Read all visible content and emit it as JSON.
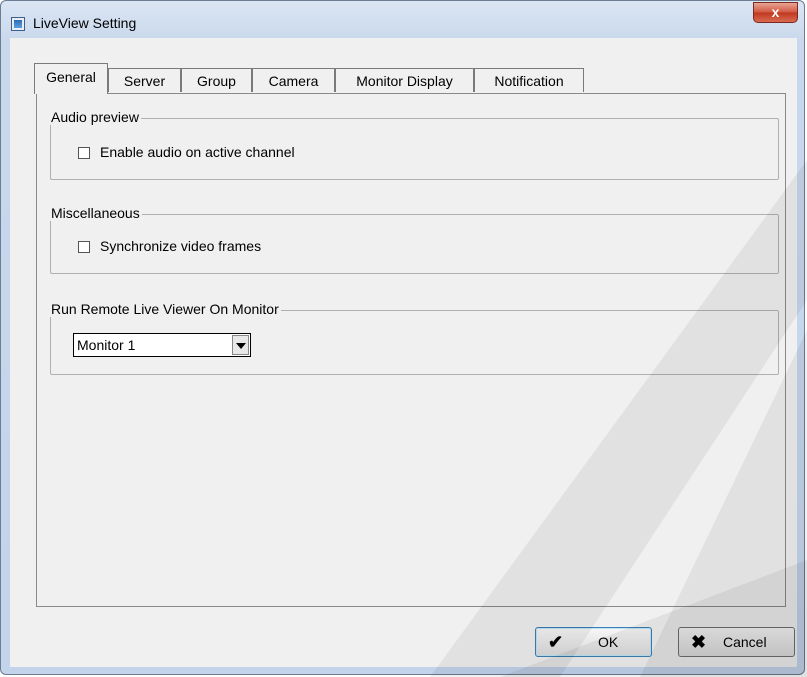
{
  "window": {
    "title": "LiveView Setting",
    "close_label": "x"
  },
  "tabs": [
    {
      "label": "General"
    },
    {
      "label": "Server"
    },
    {
      "label": "Group"
    },
    {
      "label": "Camera"
    },
    {
      "label": "Monitor Display"
    },
    {
      "label": "Notification"
    }
  ],
  "active_tab": "General",
  "audio_preview": {
    "legend": "Audio preview",
    "enable_audio": {
      "label": "Enable audio on active channel",
      "checked": false
    }
  },
  "miscellaneous": {
    "legend": "Miscellaneous",
    "sync_frames": {
      "label": "Synchronize video frames",
      "checked": false
    }
  },
  "run_remote": {
    "legend": "Run Remote Live Viewer On Monitor",
    "selected": "Monitor 1"
  },
  "buttons": {
    "ok": "OK",
    "cancel": "Cancel"
  }
}
